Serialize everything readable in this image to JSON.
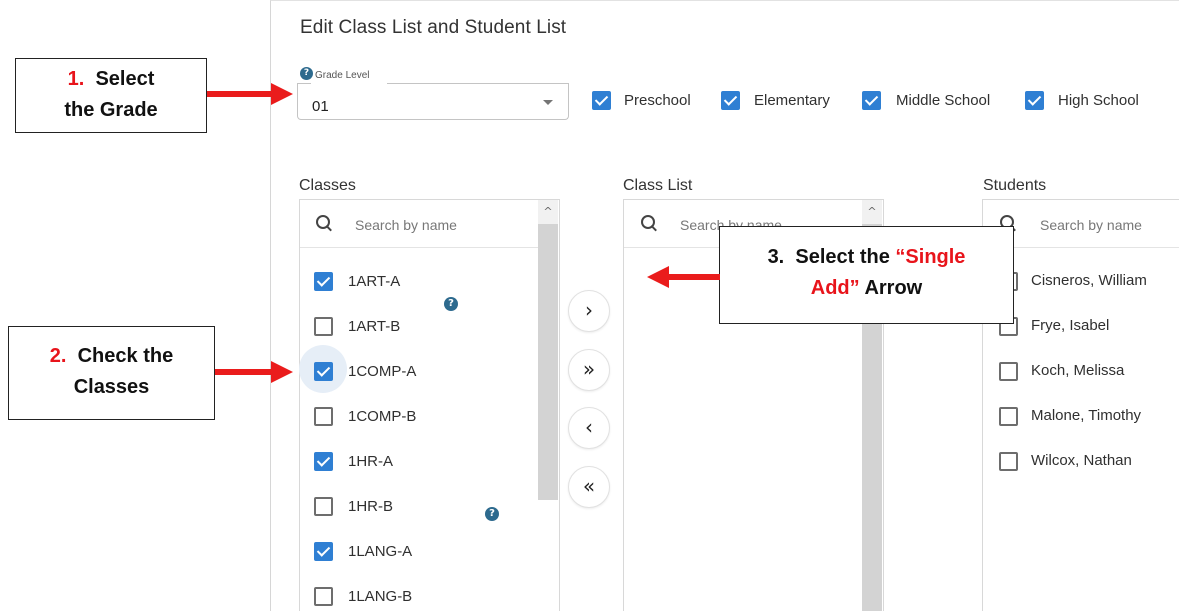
{
  "page": {
    "title": "Edit Class List and Student List"
  },
  "grade": {
    "legend": "Grade Level",
    "value": "01",
    "help": "?"
  },
  "school_levels": [
    {
      "label": "Preschool",
      "checked": true
    },
    {
      "label": "Elementary",
      "checked": true
    },
    {
      "label": "Middle School",
      "checked": true
    },
    {
      "label": "High School",
      "checked": true
    }
  ],
  "classes": {
    "heading": "Classes",
    "search_placeholder": "Search by name",
    "scroll_up": "^",
    "items": [
      {
        "label": "1ART-A",
        "checked": true
      },
      {
        "label": "1ART-B",
        "checked": false
      },
      {
        "label": "1COMP-A",
        "checked": true
      },
      {
        "label": "1COMP-B",
        "checked": false
      },
      {
        "label": "1HR-A",
        "checked": true
      },
      {
        "label": "1HR-B",
        "checked": false
      },
      {
        "label": "1LANG-A",
        "checked": true
      },
      {
        "label": "1LANG-B",
        "checked": false
      }
    ],
    "help_a": "?",
    "help_b": "?"
  },
  "transfer_buttons": {
    "single_add": "›",
    "add_all": "»",
    "single_remove": "‹",
    "remove_all": "«"
  },
  "class_list": {
    "heading": "Class List",
    "search_placeholder": "Search by name",
    "scroll_up": "^"
  },
  "students": {
    "heading": "Students",
    "search_placeholder": "Search by name",
    "items": [
      {
        "label": "Cisneros, William",
        "checked": false
      },
      {
        "label": "Frye, Isabel",
        "checked": false
      },
      {
        "label": "Koch, Melissa",
        "checked": false
      },
      {
        "label": "Malone, Timothy",
        "checked": false
      },
      {
        "label": "Wilcox, Nathan",
        "checked": false
      }
    ]
  },
  "callouts": {
    "step1": {
      "num": "1.",
      "line1": "Select",
      "line2": "the Grade"
    },
    "step2": {
      "num": "2.",
      "line1": "Check the",
      "line2": "Classes"
    },
    "step3": {
      "num": "3.",
      "line1_a": "Select the ",
      "line1_b": "“Single",
      "line2_a": "Add”",
      "line2_b": " Arrow"
    }
  },
  "colors": {
    "accent": "#2f7fd3",
    "callout_red": "#e8141b",
    "help": "#2d6a8e"
  }
}
